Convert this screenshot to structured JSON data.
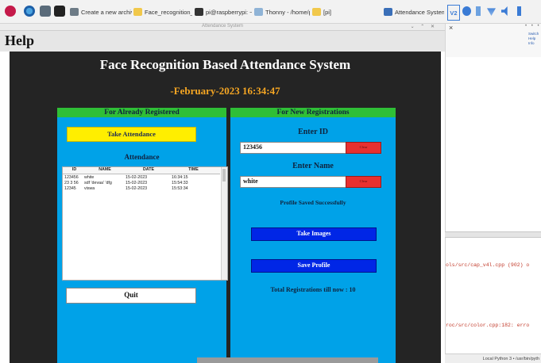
{
  "taskbar": {
    "tasks": [
      {
        "label": "Create a new archive",
        "icon": "archive-icon"
      },
      {
        "label": "Face_recognition_b...",
        "icon": "folder-icon"
      },
      {
        "label": "pi@raspberrypi: ~",
        "icon": "terminal-icon"
      },
      {
        "label": "Thonny - /home/p...",
        "icon": "thonny-icon"
      },
      {
        "label": "[pi]",
        "icon": "folder-icon"
      },
      {
        "label": "Attendance System",
        "icon": "window-icon"
      }
    ],
    "tray_vnc": "V2"
  },
  "window": {
    "title": "Attendance System",
    "controls": "⌄ ⌃ ✕"
  },
  "menu": {
    "help": "Help"
  },
  "app": {
    "title": "Face Recognition Based Attendance System",
    "datetime": "-February-2023 16:34:47",
    "left_panel": {
      "header": "For Already Registered",
      "take_attendance": "Take Attendance",
      "attendance_label": "Attendance",
      "table": {
        "columns": [
          "ID",
          "NAME",
          "DATE",
          "TIME"
        ],
        "rows": [
          [
            "123456",
            "white",
            "15-02-2023",
            "16:34:15"
          ],
          [
            "23 3 56",
            "sdf 'devaa' 'dfg",
            "15-02-2023",
            "15:54:33"
          ],
          [
            "12345",
            "viswa",
            "15-02-2023",
            "15:53:34"
          ]
        ]
      },
      "quit": "Quit"
    },
    "right_panel": {
      "header": "For New Registrations",
      "enter_id_label": "Enter ID",
      "id_value": "123456",
      "clear_label": "Clear",
      "enter_name_label": "Enter Name",
      "name_value": "white",
      "message": "Profile Saved Successfully",
      "take_images": "Take Images",
      "save_profile": "Save Profile",
      "total": "Total Registrations till now  : 10"
    }
  },
  "side": {
    "close": "×",
    "dots": "• • •",
    "links": [
      "Switch",
      "Help",
      "Info"
    ],
    "errors": [
      "ols/src/cap_v4l.cpp (902) o",
      "roc/src/color.cpp:182: erro"
    ],
    "status": "Local Python 3 • /usr/bin/pyth"
  },
  "colors": {
    "app_background": "#242424",
    "panel_blue": "#00a2e8",
    "panel_header_green": "#2fbf36",
    "datetime_orange": "#f5a623",
    "take_attendance_yellow": "#ffee00",
    "clear_red": "#e8302f",
    "button_blue": "#0026e6"
  }
}
